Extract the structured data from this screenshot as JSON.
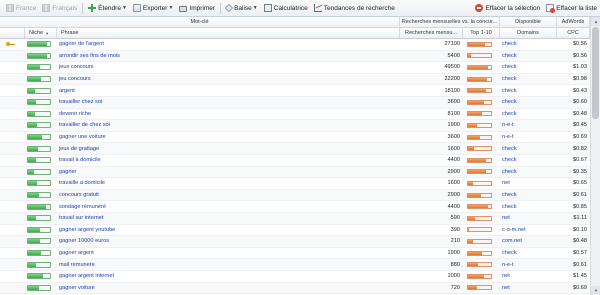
{
  "toolbar": {
    "lang1": "France",
    "lang2": "Français",
    "expand": "Étendre",
    "export": "Exporter",
    "print": "Imprimer",
    "tag": "Balise",
    "calculator": "Calculatrice",
    "trends": "Tendances de recherche",
    "delete_selection": "Effacer la sélection",
    "clear_list": "Effacer la liste"
  },
  "header_groups": {
    "keyword": "Mot-clé",
    "monthly": "Recherches mensuelles vs. la concur...",
    "available": "Disponible",
    "adwords": "AdWords"
  },
  "columns": {
    "niche": "Niche",
    "phrase": "Phrase",
    "searches": "Recherches mensu...",
    "top": "Top 1-10",
    "domains": "Domains",
    "cpc": "CPC"
  },
  "colors": {
    "link": "#1a3bbd",
    "niche_fill": "#3fa84b",
    "top_fill": "#e3742e"
  },
  "rows": [
    {
      "phrase": "gagner de l'argent",
      "niche": 0.88,
      "searches": "27100",
      "top": 0.75,
      "domain": "check",
      "cpc": "$0.56",
      "key": true
    },
    {
      "phrase": "arrondir ses fins de mois",
      "niche": 0.86,
      "searches": "5400",
      "top": 0.15,
      "domain": "check",
      "cpc": "$0.56"
    },
    {
      "phrase": "jeux concours",
      "niche": 0.55,
      "searches": "49500",
      "top": 0.85,
      "domain": "check",
      "cpc": "$1.03"
    },
    {
      "phrase": "jeu concours",
      "niche": 0.6,
      "searches": "22200",
      "top": 0.82,
      "domain": "check",
      "cpc": "$0.98"
    },
    {
      "phrase": "argent",
      "niche": 0.3,
      "searches": "18100",
      "top": 0.78,
      "domain": "check",
      "cpc": "$0.43"
    },
    {
      "phrase": "travailler chez soi",
      "niche": 0.36,
      "searches": "3600",
      "top": 0.7,
      "domain": "check",
      "cpc": "$0.60"
    },
    {
      "phrase": "devenir riche",
      "niche": 0.3,
      "searches": "8100",
      "top": 0.6,
      "domain": "check",
      "cpc": "$0.48"
    },
    {
      "phrase": "travailler de chez soi",
      "niche": 0.4,
      "searches": "1900",
      "top": 0.4,
      "domain": "n-e-t",
      "cpc": "$0.45"
    },
    {
      "phrase": "gagner une voiture",
      "niche": 0.62,
      "searches": "3600",
      "top": 0.5,
      "domain": "n-e-t",
      "cpc": "$0.69"
    },
    {
      "phrase": "jeux de grattage",
      "niche": 0.45,
      "searches": "1600",
      "top": 0.28,
      "domain": "check",
      "cpc": "$0.82"
    },
    {
      "phrase": "travail à domicile",
      "niche": 0.35,
      "searches": "4400",
      "top": 0.8,
      "domain": "check",
      "cpc": "$0.67"
    },
    {
      "phrase": "gagner",
      "niche": 0.28,
      "searches": "2900",
      "top": 0.8,
      "domain": "check",
      "cpc": "$0.35"
    },
    {
      "phrase": "travaille a domicile",
      "niche": 0.4,
      "searches": "1600",
      "top": 0.22,
      "domain": "net",
      "cpc": "$0.65"
    },
    {
      "phrase": "concours gratuit",
      "niche": 0.5,
      "searches": "2900",
      "top": 0.55,
      "domain": "check",
      "cpc": "$0.61"
    },
    {
      "phrase": "sondage rémunéré",
      "niche": 0.82,
      "searches": "4400",
      "top": 0.85,
      "domain": "check",
      "cpc": "$0.85"
    },
    {
      "phrase": "travail sur internet",
      "niche": 0.38,
      "searches": "590",
      "top": 0.3,
      "domain": "net",
      "cpc": "$1.11"
    },
    {
      "phrase": "gagner argent youtube",
      "niche": 0.55,
      "searches": "390",
      "top": 0.05,
      "domain": "c-o-m.net",
      "cpc": "$0.10"
    },
    {
      "phrase": "gagner 10000 euros",
      "niche": 0.55,
      "searches": "210",
      "top": 0.2,
      "domain": "com.net",
      "cpc": "$0.48"
    },
    {
      "phrase": "gagner argent",
      "niche": 0.6,
      "searches": "1900",
      "top": 0.6,
      "domain": "check",
      "cpc": "$0.57"
    },
    {
      "phrase": "mail remunere",
      "niche": 0.38,
      "searches": "880",
      "top": 0.45,
      "domain": "n-e-t",
      "cpc": "$0.61"
    },
    {
      "phrase": "gagner argent internet",
      "niche": 0.7,
      "searches": "1000",
      "top": 0.7,
      "domain": "net",
      "cpc": "$1.45"
    },
    {
      "phrase": "gagner voiture",
      "niche": 0.5,
      "searches": "720",
      "top": 0.4,
      "domain": "net",
      "cpc": "$0.69"
    }
  ]
}
